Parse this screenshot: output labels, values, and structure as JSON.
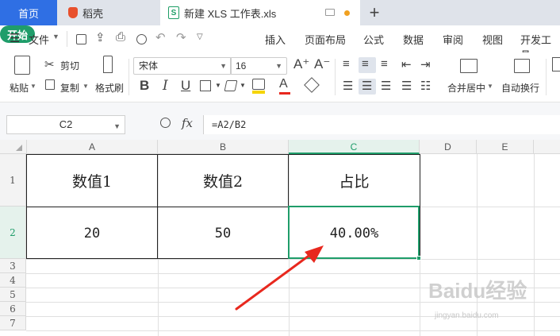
{
  "tabs": {
    "home": "首页",
    "daoke": "稻壳",
    "doc": "新建 XLS 工作表.xls",
    "add": "+"
  },
  "menu": {
    "file": "文件",
    "items": [
      "开始",
      "插入",
      "页面布局",
      "公式",
      "数据",
      "审阅",
      "视图",
      "开发工具"
    ]
  },
  "ribbon": {
    "paste": "粘贴",
    "cut": "剪切",
    "copy": "复制",
    "format_painter": "格式刷",
    "font": "宋体",
    "size": "16",
    "merge_center": "合并居中",
    "wrap_text": "自动换行",
    "bold": "B",
    "italic": "I",
    "underline": "U",
    "font_color_letter": "A",
    "grow_font": "A⁺",
    "shrink_font": "A⁻"
  },
  "formula_bar": {
    "name_box": "C2",
    "fx": "fx",
    "formula": "=A2/B2"
  },
  "grid": {
    "columns": [
      "A",
      "B",
      "C",
      "D",
      "E"
    ],
    "rows": [
      "1",
      "2",
      "3",
      "4",
      "5",
      "6",
      "7"
    ],
    "cells": {
      "A1": "数值1",
      "B1": "数值2",
      "C1": "占比",
      "A2": "20",
      "B2": "50",
      "C2": "40.00%"
    }
  },
  "watermark": {
    "text": "Baidu经验",
    "sub": "jingyan.baidu.com"
  },
  "colors": {
    "accent": "#1f9d6a",
    "tab_active": "#2f6fe4",
    "arrow": "#e8281e"
  }
}
